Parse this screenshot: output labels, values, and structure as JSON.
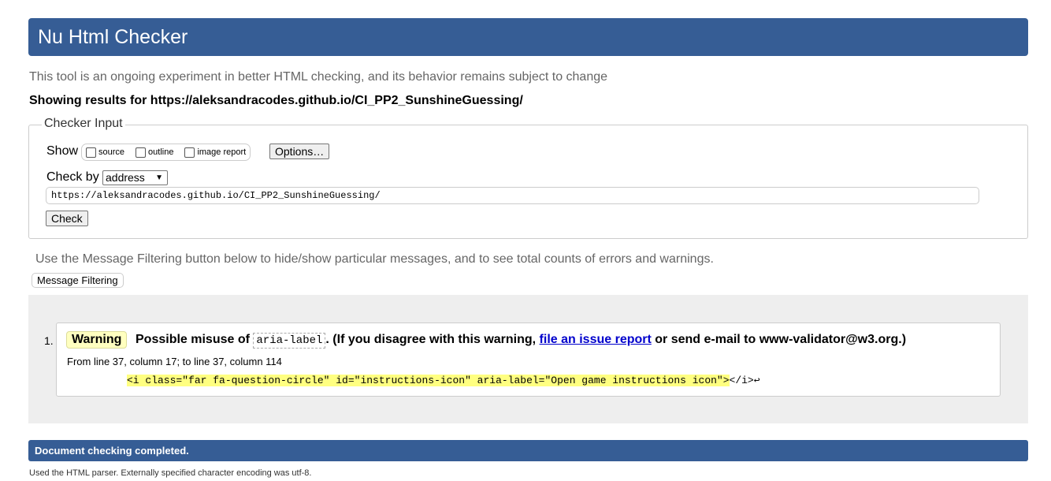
{
  "header": {
    "title": "Nu Html Checker"
  },
  "intro": "This tool is an ongoing experiment in better HTML checking, and its behavior remains subject to change",
  "showing": "Showing results for https://aleksandracodes.github.io/CI_PP2_SunshineGuessing/",
  "form": {
    "legend": "Checker Input",
    "show_label": "Show",
    "checkboxes": [
      "source",
      "outline",
      "image report"
    ],
    "options_button": "Options…",
    "checkby_label": "Check by",
    "checkby_value": "address",
    "url_value": "https://aleksandracodes.github.io/CI_PP2_SunshineGuessing/",
    "check_button": "Check"
  },
  "filter": {
    "info": "Use the Message Filtering button below to hide/show particular messages, and to see total counts of errors and warnings.",
    "button": "Message Filtering"
  },
  "messages": [
    {
      "number": "1.",
      "type": "Warning",
      "text_before": "Possible misuse of ",
      "code": "aria-label",
      "text_mid": ". (If you disagree with this warning, ",
      "link": "file an issue report",
      "text_after": " or send e-mail to www-validator@w3.org.)",
      "location": "From line 37, column 17; to line 37, column 114",
      "extract": "<i class=\"far fa-question-circle\" id=\"instructions-icon\" aria-label=\"Open game instructions icon\">",
      "extract_tail": "</i>↩"
    }
  ],
  "done": "Document checking completed.",
  "footer": "Used the HTML parser. Externally specified character encoding was utf-8."
}
